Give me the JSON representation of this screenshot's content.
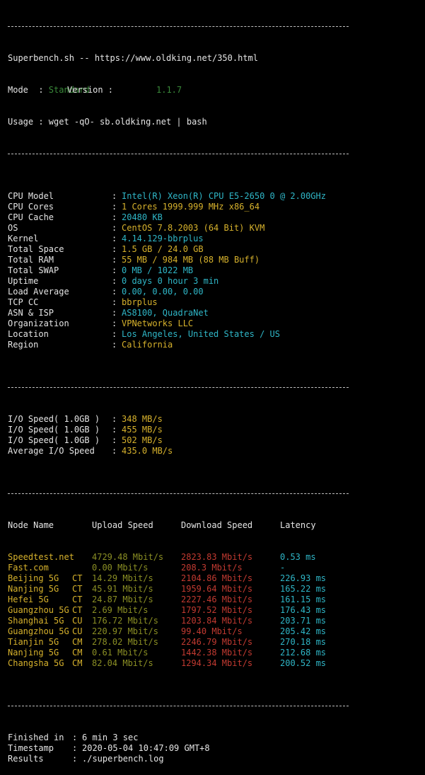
{
  "header": {
    "banner": "Superbench.sh -- https://www.oldking.net/350.html",
    "mode_label": "Mode  : ",
    "mode_value": "Standard",
    "version_label": "Version : ",
    "version_value": "1.1.7",
    "usage": "Usage : wget -qO- sb.oldking.net | bash"
  },
  "sysinfo": [
    {
      "key": "CPU Model",
      "value": "Intel(R) Xeon(R) CPU E5-2650 0 @ 2.00GHz",
      "color": "cyan"
    },
    {
      "key": "CPU Cores",
      "value": "1 Cores 1999.999 MHz x86_64",
      "color": "yellow"
    },
    {
      "key": "CPU Cache",
      "value": "20480 KB",
      "color": "cyan"
    },
    {
      "key": "OS",
      "value": "CentOS 7.8.2003 (64 Bit) KVM",
      "color": "yellow"
    },
    {
      "key": "Kernel",
      "value": "4.14.129-bbrplus",
      "color": "cyan"
    },
    {
      "key": "Total Space",
      "value": "1.5 GB / 24.0 GB",
      "color": "yellow"
    },
    {
      "key": "Total RAM",
      "value": "55 MB / 984 MB (88 MB Buff)",
      "color": "yellow"
    },
    {
      "key": "Total SWAP",
      "value": "0 MB / 1022 MB",
      "color": "cyan"
    },
    {
      "key": "Uptime",
      "value": "0 days 0 hour 3 min",
      "color": "cyan"
    },
    {
      "key": "Load Average",
      "value": "0.00, 0.00, 0.00",
      "color": "cyan"
    },
    {
      "key": "TCP CC",
      "value": "bbrplus",
      "color": "yellow"
    },
    {
      "key": "ASN & ISP",
      "value": "AS8100, QuadraNet",
      "color": "cyan"
    },
    {
      "key": "Organization",
      "value": "VPNetworks LLC",
      "color": "yellow"
    },
    {
      "key": "Location",
      "value": "Los Angeles, United States / US",
      "color": "cyan"
    },
    {
      "key": "Region",
      "value": "California",
      "color": "yellow"
    }
  ],
  "io": [
    {
      "key": "I/O Speed( 1.0GB )",
      "value": "348 MB/s"
    },
    {
      "key": "I/O Speed( 1.0GB )",
      "value": "455 MB/s"
    },
    {
      "key": "I/O Speed( 1.0GB )",
      "value": "502 MB/s"
    },
    {
      "key": "Average I/O Speed",
      "value": "435.0 MB/s"
    }
  ],
  "speed_header": {
    "node": "Node Name",
    "upload": "Upload Speed",
    "download": "Download Speed",
    "latency": "Latency"
  },
  "speed_rows": [
    {
      "node": "Speedtest.net",
      "isp": "",
      "node_color": "yellow",
      "upload": "4729.48 Mbit/s",
      "download": "2823.83 Mbit/s",
      "latency": "0.53 ms"
    },
    {
      "node": "Fast.com",
      "isp": "",
      "node_color": "yellow",
      "upload": "0.00 Mbit/s",
      "download": "208.3 Mbit/s",
      "latency": "-"
    },
    {
      "node": "Beijing 5G",
      "isp": "CT",
      "node_color": "yellow",
      "upload": "14.29 Mbit/s",
      "download": "2104.86 Mbit/s",
      "latency": "226.93 ms"
    },
    {
      "node": "Nanjing 5G",
      "isp": "CT",
      "node_color": "yellow",
      "upload": "45.91 Mbit/s",
      "download": "1959.64 Mbit/s",
      "latency": "165.22 ms"
    },
    {
      "node": "Hefei 5G",
      "isp": "CT",
      "node_color": "yellow",
      "upload": "24.87 Mbit/s",
      "download": "2227.46 Mbit/s",
      "latency": "161.15 ms"
    },
    {
      "node": "Guangzhou 5G",
      "isp": "CT",
      "node_color": "yellow",
      "upload": "2.69 Mbit/s",
      "download": "1797.52 Mbit/s",
      "latency": "176.43 ms"
    },
    {
      "node": "Shanghai 5G",
      "isp": "CU",
      "node_color": "yellow",
      "upload": "176.72 Mbit/s",
      "download": "1203.84 Mbit/s",
      "latency": "203.71 ms"
    },
    {
      "node": "Guangzhou 5G",
      "isp": "CU",
      "node_color": "yellow",
      "upload": "220.97 Mbit/s",
      "download": "99.40 Mbit/s",
      "latency": "205.42 ms"
    },
    {
      "node": "Tianjin 5G",
      "isp": "CM",
      "node_color": "yellow",
      "upload": "278.02 Mbit/s",
      "download": "2246.79 Mbit/s",
      "latency": "270.18 ms"
    },
    {
      "node": "Nanjing 5G",
      "isp": "CM",
      "node_color": "yellow",
      "upload": "0.61 Mbit/s",
      "download": "1442.38 Mbit/s",
      "latency": "212.68 ms"
    },
    {
      "node": "Changsha 5G",
      "isp": "CM",
      "node_color": "yellow",
      "upload": "82.04 Mbit/s",
      "download": "1294.34 Mbit/s",
      "latency": "200.52 ms"
    }
  ],
  "footer": [
    {
      "key": "Finished in",
      "value": "6 min 3 sec"
    },
    {
      "key": "Timestamp",
      "value": "2020-05-04 10:47:09 GMT+8"
    },
    {
      "key": "Results",
      "value": "./superbench.log"
    }
  ],
  "colors": {
    "background": "#000000",
    "text": "#e5e5e5",
    "yellow": "#d7b22c",
    "cyan": "#2fb6c7",
    "green": "#3a8a3a",
    "red": "#c23a31",
    "olive": "#8b8f24"
  }
}
